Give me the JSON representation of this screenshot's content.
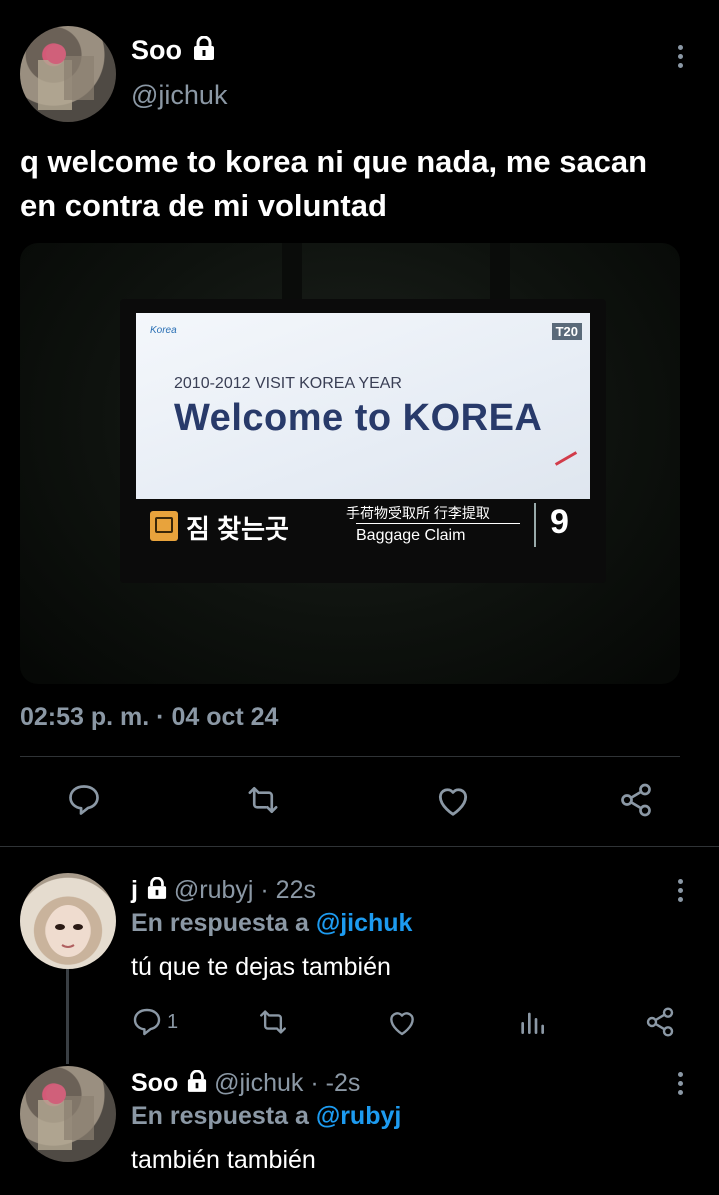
{
  "tweet": {
    "author": {
      "name": "Soo",
      "handle": "@jichuk"
    },
    "text_line1": "q welcome to korea ni que nada, me sacan",
    "text_line2": "en contra de mi voluntad",
    "image": {
      "logo_text": "Korea",
      "tag": "T20",
      "subtitle": "2010-2012 VISIT KOREA YEAR",
      "headline": "Welcome to KOREA",
      "korean": "짐 찾는곳",
      "chinese": "手荷物受取所 行李提取",
      "english": "Baggage Claim",
      "gate": "9"
    },
    "timestamp": "02:53 p. m. · 04 oct 24"
  },
  "replies": [
    {
      "name": "j",
      "handle": "@rubyj",
      "time": "· 22s",
      "reply_prefix": "En respuesta a",
      "reply_to": "@jichuk",
      "text": "tú que te dejas también",
      "reply_count": "1"
    },
    {
      "name": "Soo",
      "handle": "@jichuk",
      "time": "· -2s",
      "reply_prefix": "En respuesta a",
      "reply_to": "@rubyj",
      "text": "también también"
    }
  ],
  "icons": [
    "lock-icon",
    "more-icon",
    "reply-icon",
    "retweet-icon",
    "like-icon",
    "share-icon",
    "analytics-icon"
  ]
}
